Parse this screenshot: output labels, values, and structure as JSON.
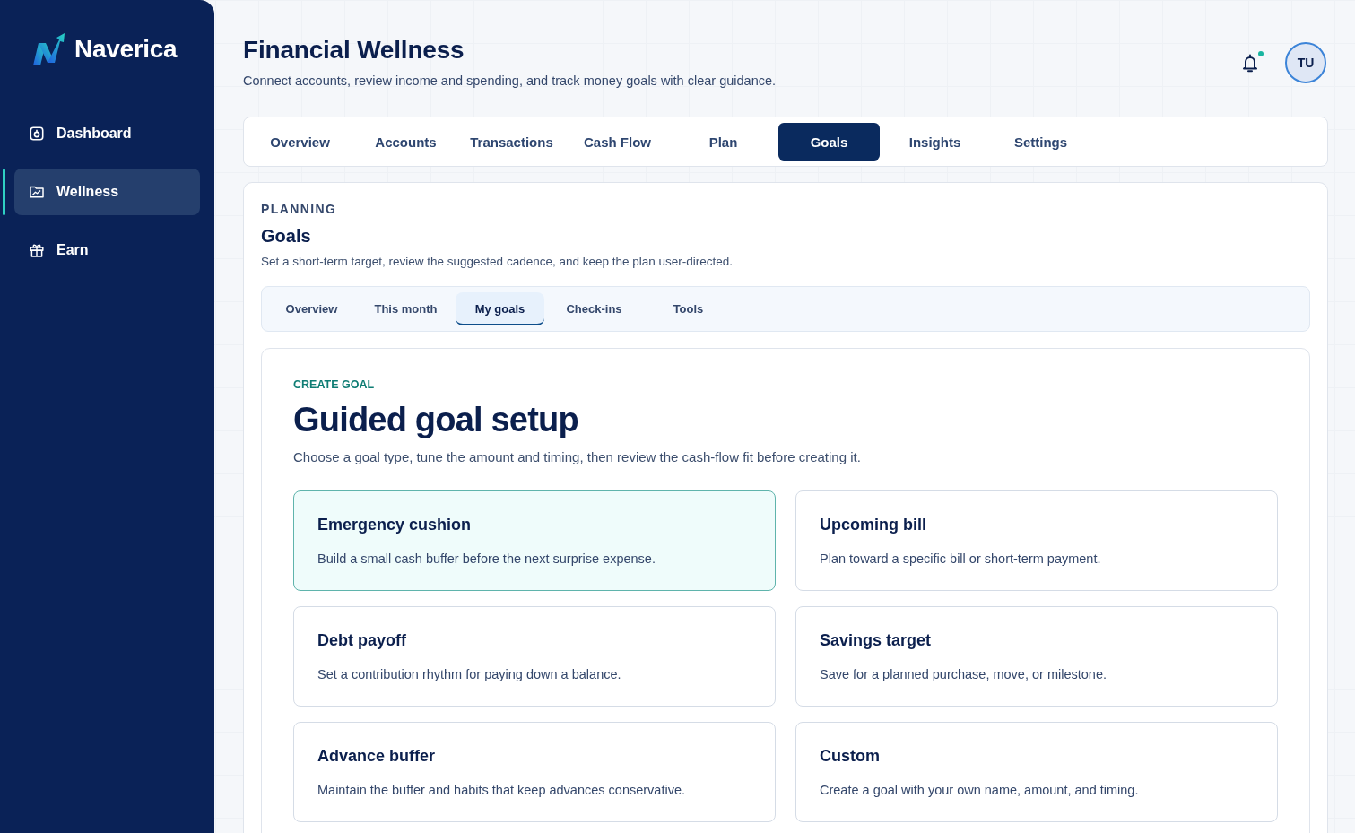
{
  "sidebar": {
    "brand": "Naverica",
    "items": [
      {
        "label": "Dashboard",
        "selected": false
      },
      {
        "label": "Wellness",
        "selected": true
      },
      {
        "label": "Earn",
        "selected": false
      }
    ]
  },
  "header": {
    "title": "Financial Wellness",
    "subtitle": "Connect accounts, review income and spending, and track money goals with clear guidance.",
    "notifications": {
      "unread": true
    },
    "avatar": {
      "initials": "TU"
    }
  },
  "tabs": [
    {
      "label": "Overview",
      "selected": false
    },
    {
      "label": "Accounts",
      "selected": false
    },
    {
      "label": "Transactions",
      "selected": false
    },
    {
      "label": "Cash Flow",
      "selected": false
    },
    {
      "label": "Plan",
      "selected": false
    },
    {
      "label": "Goals",
      "selected": true
    },
    {
      "label": "Insights",
      "selected": false
    },
    {
      "label": "Settings",
      "selected": false
    }
  ],
  "section": {
    "eyebrow": "PLANNING",
    "title": "Goals",
    "description": "Set a short-term target, review the suggested cadence, and keep the plan user-directed.",
    "subtabs": [
      {
        "label": "Overview",
        "selected": false
      },
      {
        "label": "This month",
        "selected": false
      },
      {
        "label": "My goals",
        "selected": true
      },
      {
        "label": "Check-ins",
        "selected": false
      },
      {
        "label": "Tools",
        "selected": false
      }
    ],
    "create_goal": {
      "eyebrow": "CREATE GOAL",
      "title": "Guided goal setup",
      "description": "Choose a goal type, tune the amount and timing, then review the cash-flow fit before creating it.",
      "goal_types": [
        {
          "title": "Emergency cushion",
          "description": "Build a small cash buffer before the next surprise expense.",
          "selected": true
        },
        {
          "title": "Upcoming bill",
          "description": "Plan toward a specific bill or short-term payment.",
          "selected": false
        },
        {
          "title": "Debt payoff",
          "description": "Set a contribution rhythm for paying down a balance.",
          "selected": false
        },
        {
          "title": "Savings target",
          "description": "Save for a planned purchase, move, or milestone.",
          "selected": false
        },
        {
          "title": "Advance buffer",
          "description": "Maintain the buffer and habits that keep advances conservative.",
          "selected": false
        },
        {
          "title": "Custom",
          "description": "Create a goal with your own name, amount, and timing.",
          "selected": false
        }
      ]
    }
  }
}
